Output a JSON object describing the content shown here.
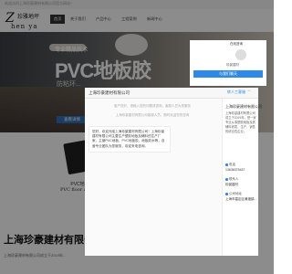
{
  "strip": {
    "text": "欢迎访问上海珍豪建材有限公司官方网站！"
  },
  "logo": {
    "mark": "Z",
    "cn": "珍雅地坪",
    "en": "hen ya"
  },
  "nav": [
    "首页",
    "关于我们",
    "产品中心",
    "工程案例",
    "新闻中心"
  ],
  "hero": {
    "line1": "专业精品技术",
    "line2": "PVC地板胶",
    "subtitle": "防粘环...",
    "button": "查看详情"
  },
  "product": {
    "name_cn": "PVC地板胶",
    "name_en": "PVC floor adhesive"
  },
  "company": {
    "title": "上海珍豪建材有限公司",
    "desc": "上海珍豪建材有限公司成立于2019年..."
  },
  "dialog": {
    "title": "上海珍豪建材有限公司",
    "transfer": "转人工客服",
    "notice1": "客户您好，请输入您的问题或咨询，客服人员为您服务",
    "notice2": "上海珍豪建材有限公司客服人员，随时欢迎您的咨询",
    "message": "您好，欢迎光临上海珍豪建材有限公司！上海珍豪建材有限公司主要生产塑胶地板及辅料的生产厂家，主营PVC地板、PVC地板胶、地板胶水等，自营专业团队为您服务，欢迎来电咨询。"
  },
  "side": {
    "company": "上海珍豪建材有限公司",
    "desc": "上海珍豪建材有限公司成立于2019年，是一家专业从事塑胶地板及其辅料研发、生产、销售的综合性企业。",
    "phone_label": "电话",
    "phone": "13636375437",
    "contact_label": "联系人",
    "contact": "珍豪建材",
    "address_label": "公司地址",
    "address": "上海市嘉定区黄渡镇..."
  },
  "topcard": {
    "title": "在线咨询",
    "name": "珍豪建材",
    "button": "与我们聊天"
  }
}
